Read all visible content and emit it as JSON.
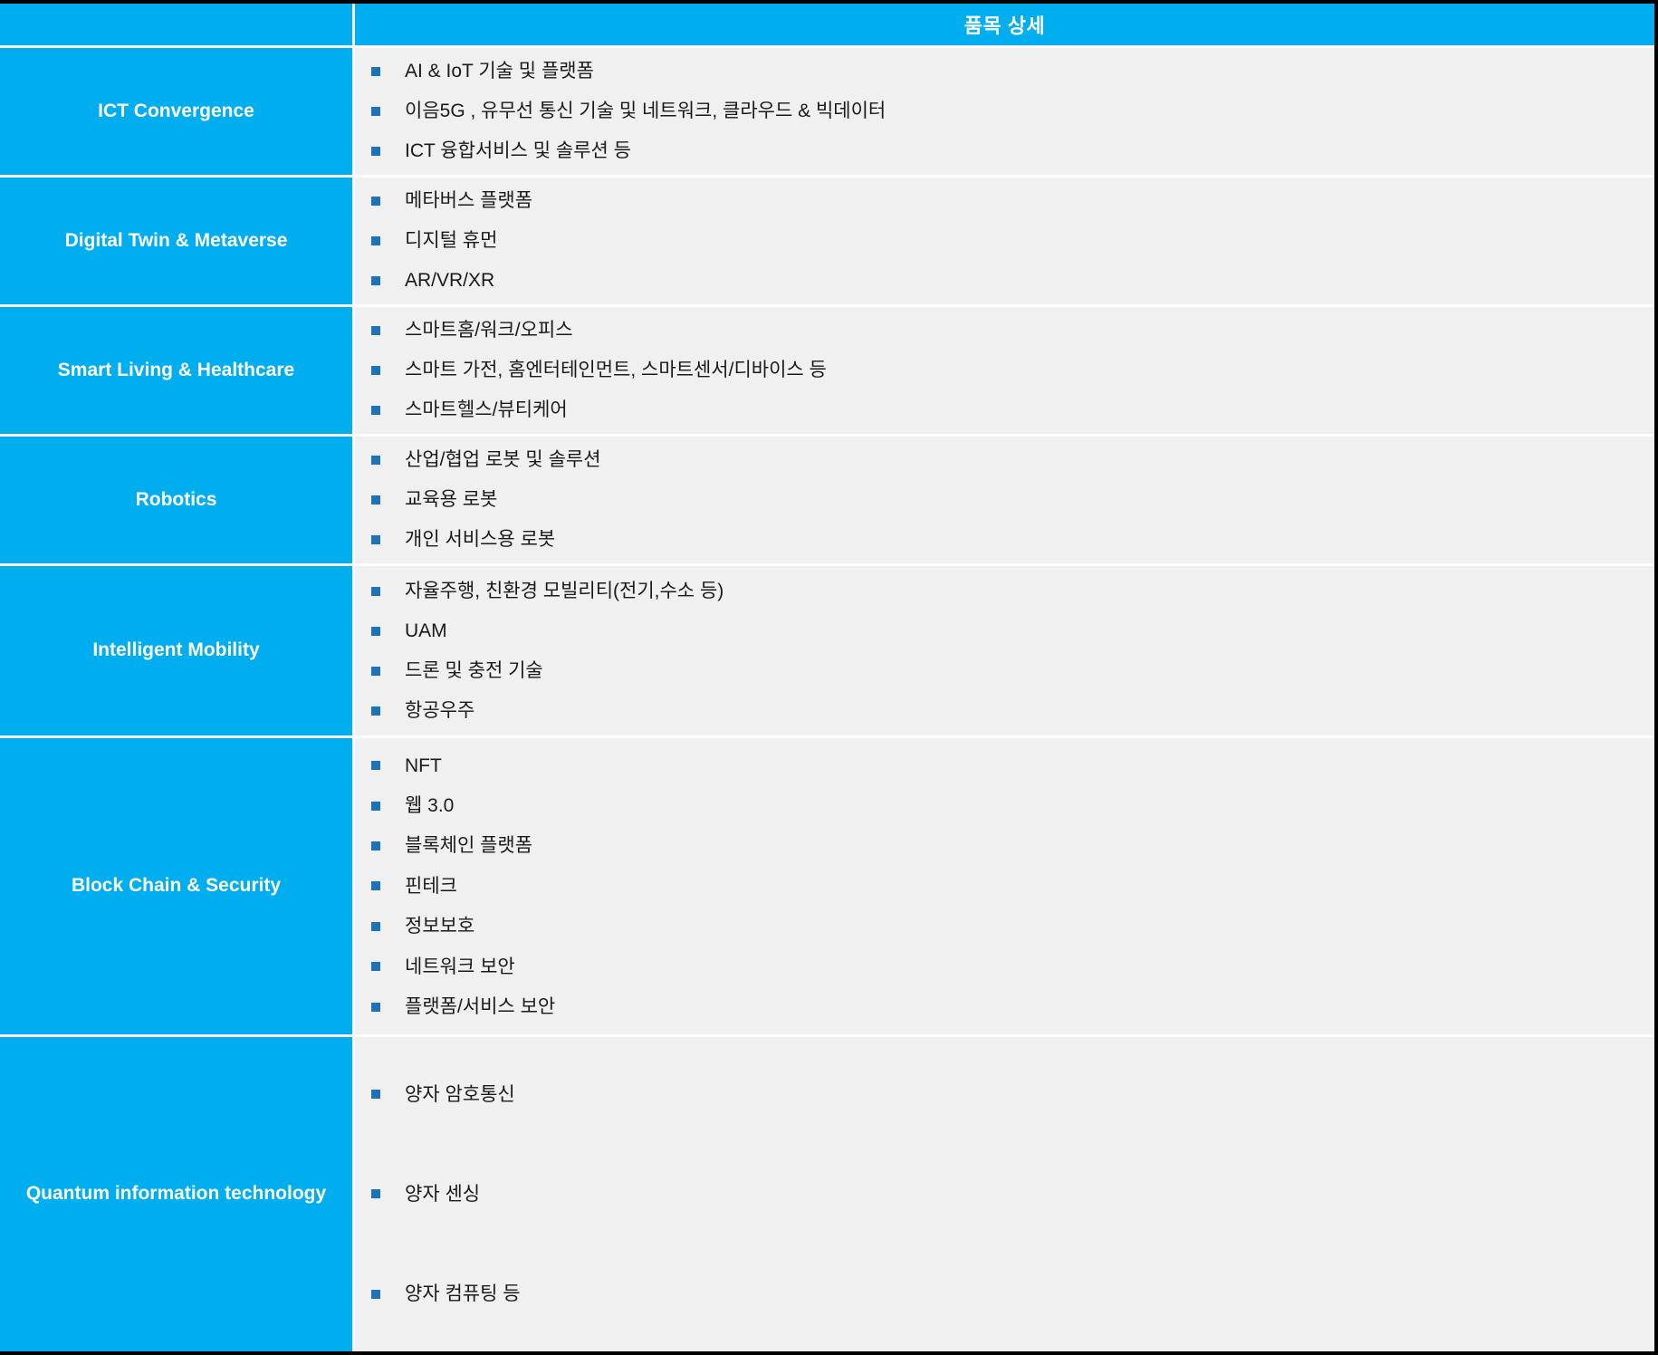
{
  "header": {
    "left_label": "",
    "detail_title": "품목 상세"
  },
  "colors": {
    "accent": "#00AEEF",
    "detail_background": "#f0f0f0",
    "bullet": "#1F72B5",
    "category_text": "#ffffff",
    "detail_text": "#1a1a1a",
    "page_background": "#000000"
  },
  "icons": {
    "bullet": "square-bullet-icon"
  },
  "rows": [
    {
      "category": "ICT Convergence",
      "items": [
        "AI & IoT 기술 및 플랫폼",
        "이음5G , 유무선 통신 기술 및 네트워크, 클라우드 & 빅데이터",
        "ICT 융합서비스 및 솔루션 등"
      ]
    },
    {
      "category": "Digital Twin & Metaverse",
      "items": [
        "메타버스 플랫폼",
        "디지털 휴먼",
        "AR/VR/XR"
      ]
    },
    {
      "category": "Smart Living & Healthcare",
      "items": [
        "스마트홈/워크/오피스",
        "스마트 가전, 홈엔터테인먼트,  스마트센서/디바이스 등",
        "스마트헬스/뷰티케어"
      ]
    },
    {
      "category": "Robotics",
      "items": [
        "산업/협업 로봇 및 솔루션",
        "교육용 로봇",
        "개인 서비스용 로봇"
      ]
    },
    {
      "category": "Intelligent Mobility",
      "items": [
        "자율주행, 친환경 모빌리티(전기,수소 등)",
        "UAM",
        "드론 및 충전 기술",
        "항공우주"
      ]
    },
    {
      "category": "Block Chain & Security",
      "items": [
        "NFT",
        "웹 3.0",
        "블록체인 플랫폼",
        "핀테크",
        "정보보호",
        "네트워크 보안",
        "플랫폼/서비스 보안"
      ]
    },
    {
      "category": "Quantum information technology",
      "items": [
        "양자 암호통신",
        "양자 센싱",
        "양자 컴퓨팅 등"
      ]
    }
  ]
}
